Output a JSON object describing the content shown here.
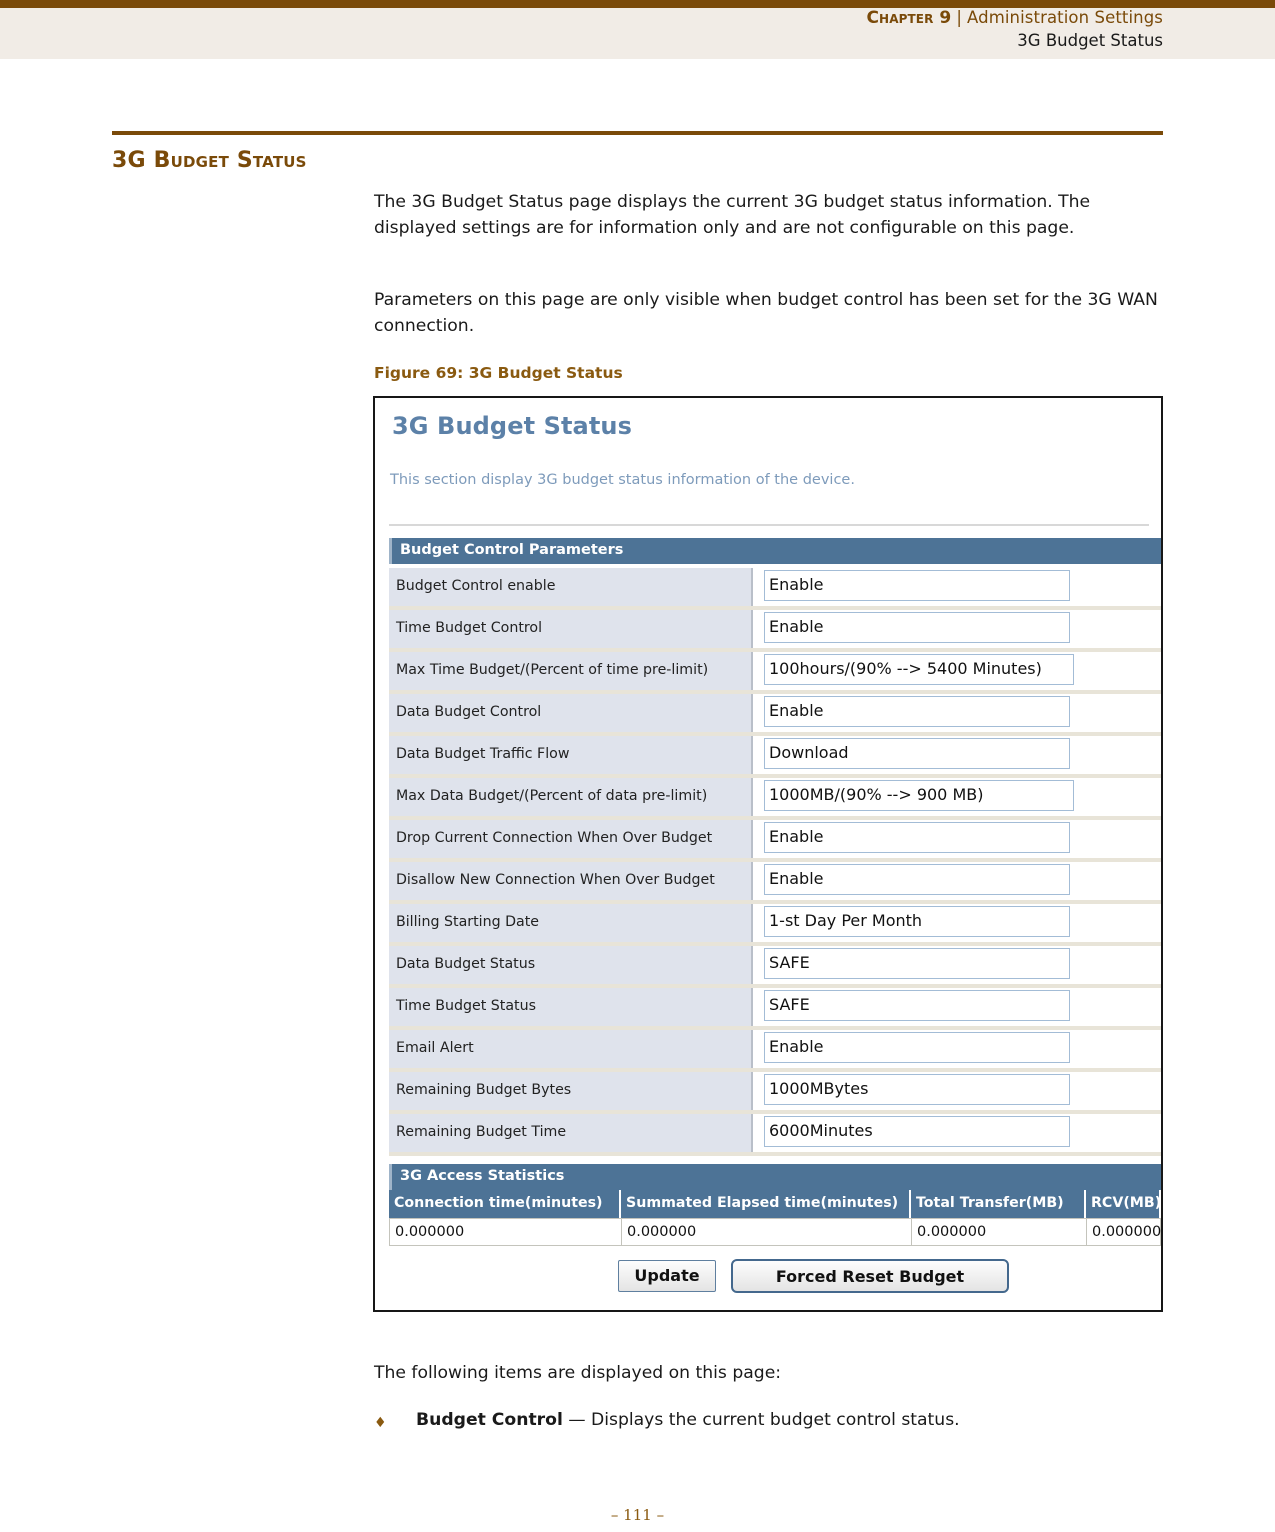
{
  "running_header": {
    "chapter_label": "Chapter 9",
    "separator": "|",
    "chapter_title": "Administration Settings",
    "section_title": "3G Budget Status"
  },
  "section": {
    "heading": "3G Budget Status",
    "paragraph_1": "The 3G Budget Status page displays the current 3G budget status information. The displayed settings are for information only and are not configurable on this page.",
    "paragraph_2": "Parameters on this page are only visible when budget control has been set for the 3G WAN connection.",
    "figure_caption": "Figure 69:  3G Budget Status",
    "paragraph_3": "The following items are displayed on this page:",
    "bullet_marker": "♦",
    "bullet_term": "Budget Control",
    "bullet_dash": "—",
    "bullet_description": "Displays the current budget control status."
  },
  "figure": {
    "ui_title": "3G Budget Status",
    "ui_subtitle": "This section display 3G budget status information of the device.",
    "params_section_title": "Budget Control Parameters",
    "params": [
      {
        "label": "Budget Control enable",
        "value": "Enable"
      },
      {
        "label": "Time Budget Control",
        "value": "Enable"
      },
      {
        "label": "Max Time Budget/(Percent of time pre-limit)",
        "value": "100hours/(90% --> 5400 Minutes)"
      },
      {
        "label": "Data Budget Control",
        "value": "Enable"
      },
      {
        "label": "Data Budget Traffic Flow",
        "value": "Download"
      },
      {
        "label": "Max Data Budget/(Percent of data pre-limit)",
        "value": "1000MB/(90% --> 900 MB)"
      },
      {
        "label": "Drop Current Connection When Over Budget",
        "value": "Enable"
      },
      {
        "label": "Disallow New Connection When Over Budget",
        "value": "Enable"
      },
      {
        "label": "Billing Starting Date",
        "value": "1-st Day Per Month"
      },
      {
        "label": "Data Budget Status",
        "value": "SAFE"
      },
      {
        "label": "Time Budget Status",
        "value": "SAFE"
      },
      {
        "label": "Email Alert",
        "value": "Enable"
      },
      {
        "label": "Remaining Budget Bytes",
        "value": "1000MBytes"
      },
      {
        "label": "Remaining Budget Time",
        "value": "6000Minutes"
      }
    ],
    "stats_section_title": "3G Access Statistics",
    "stats_columns": [
      "Connection time(minutes)",
      "Summated Elapsed time(minutes)",
      "Total Transfer(MB)",
      "RCV(MB)"
    ],
    "stats_values": [
      "0.000000",
      "0.000000",
      "0.000000",
      "0.000000"
    ],
    "buttons": {
      "update": "Update",
      "forced_reset": "Forced Reset Budget"
    }
  },
  "footer": {
    "page_number": "–  111  –"
  },
  "colors": {
    "brand_brown": "#7a4a09",
    "header_band": "#f1ece6",
    "ui_title_blue": "#5c81a8",
    "section_bar_blue": "#4d7396",
    "label_cell": "#dfe3ec",
    "row_separator": "#e8e4d8"
  }
}
